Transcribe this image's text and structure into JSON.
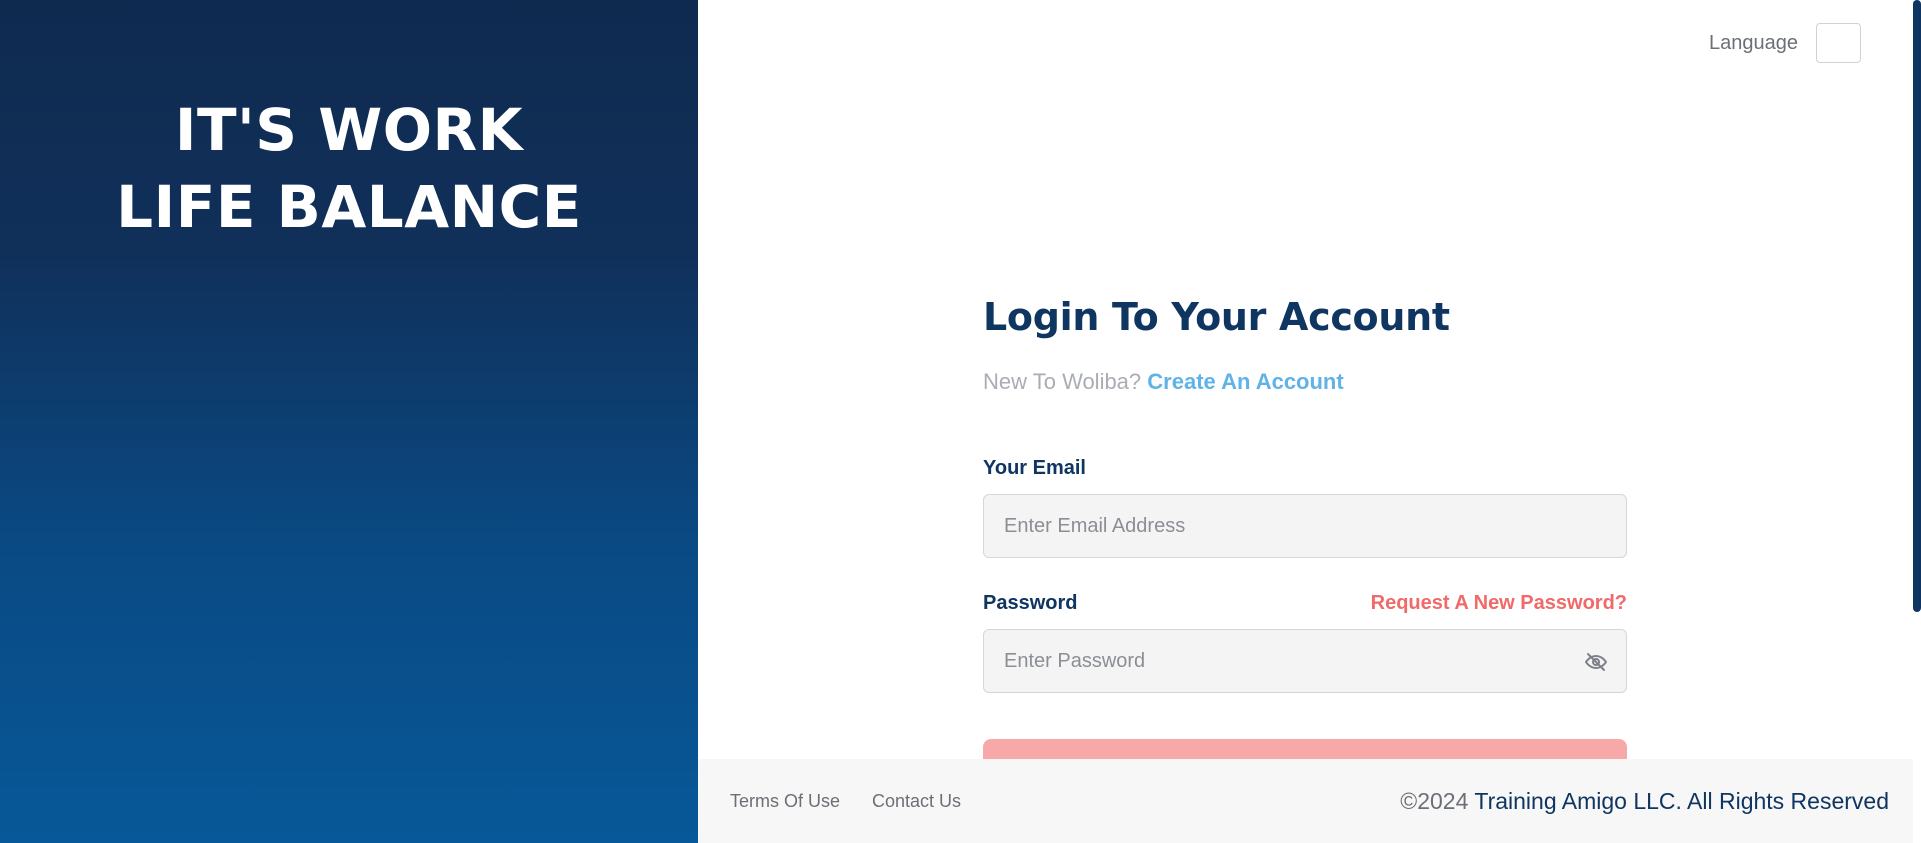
{
  "hero": {
    "line1": "IT'S WORK",
    "line2": "LIFE BALANCE"
  },
  "header": {
    "language_label": "Language",
    "language_value": ""
  },
  "login": {
    "title": "Login To Your Account",
    "signup_prompt": "New To Woliba?",
    "signup_link": "Create An Account",
    "email_label": "Your Email",
    "email_placeholder": "Enter Email Address",
    "password_label": "Password",
    "forgot_link": "Request A New Password?",
    "password_placeholder": "Enter Password"
  },
  "footer": {
    "links": [
      "Terms Of Use",
      "Contact Us"
    ],
    "copyright_year": "©2024",
    "copyright_text": "Training Amigo LLC. All Rights Reserved"
  },
  "colors": {
    "hero_top": "#0f2a4f",
    "hero_bottom": "#075898",
    "primary_text": "#0f3561",
    "link_blue": "#5fb3e8",
    "accent_red": "#f06a6a"
  },
  "icons": {
    "password_toggle": "eye-slash-icon"
  }
}
